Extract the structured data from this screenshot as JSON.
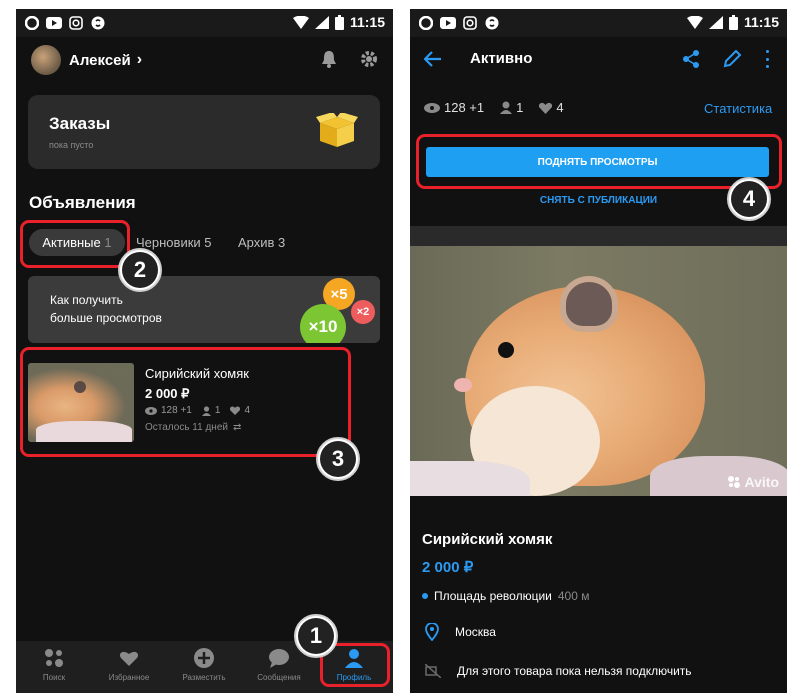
{
  "status": {
    "time": "11:15"
  },
  "left": {
    "header": {
      "user_name": "Алексей"
    },
    "orders": {
      "title": "Заказы",
      "subtitle": "пока пусто"
    },
    "ads_title": "Объявления",
    "tabs": [
      {
        "label": "Активные",
        "count": "1"
      },
      {
        "label": "Черновики 5"
      },
      {
        "label": "Архив 3"
      }
    ],
    "promo": {
      "line1": "Как получить",
      "line2": "больше просмотров",
      "badge_x5": "×5",
      "badge_x2": "×2",
      "badge_x10": "×10"
    },
    "listing": {
      "title": "Сирийский хомяк",
      "price": "2 000 ₽",
      "views": "128 +1",
      "users": "1",
      "likes": "4",
      "remaining": "Осталось 11 дней"
    },
    "nav": [
      {
        "label": "Поиск",
        "icon": "grid-icon"
      },
      {
        "label": "Избранное",
        "icon": "heart-icon"
      },
      {
        "label": "Разместить",
        "icon": "plus-icon"
      },
      {
        "label": "Сообщения",
        "icon": "chat-icon"
      },
      {
        "label": "Профиль",
        "icon": "person-icon"
      }
    ]
  },
  "right": {
    "title": "Активно",
    "stats": {
      "views": "128 +1",
      "users": "1",
      "likes": "4",
      "link": "Статистика"
    },
    "raise_button": "ПОДНЯТЬ ПРОСМОТРЫ",
    "unpublish": "СНЯТЬ С ПУБЛИКАЦИИ",
    "watermark": "Avito",
    "listing_title": "Сирийский хомяк",
    "price": "2 000 ₽",
    "metro": "Площадь революции",
    "metro_dist": "400 м",
    "city": "Москва",
    "delivery_note": "Для этого товара пока нельзя подключить"
  },
  "markers": [
    "1",
    "2",
    "3",
    "4"
  ],
  "colors": {
    "accent": "#2b9af3",
    "highlight": "#e8212a",
    "bg": "#111111"
  }
}
